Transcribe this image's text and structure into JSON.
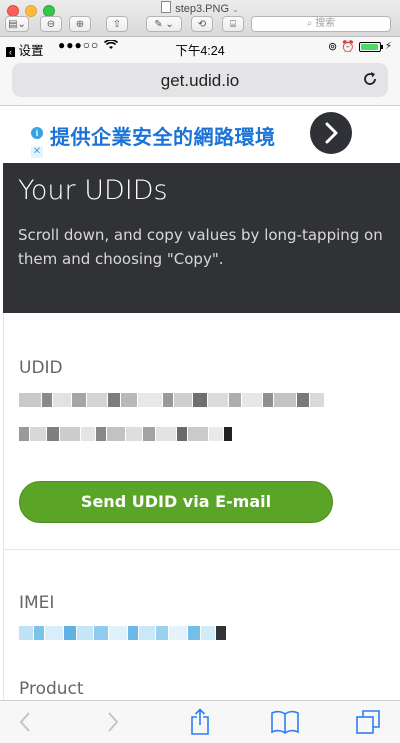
{
  "window": {
    "title": "step3.PNG",
    "search_placeholder": "搜索"
  },
  "status_bar": {
    "back_label": "设置",
    "carrier_dots": "●●●○○",
    "time": "下午4:24"
  },
  "address_bar": {
    "url": "get.udid.io"
  },
  "ad": {
    "text": "提供企業安全的網路環境",
    "info_glyph": "i",
    "close_glyph": "✕"
  },
  "hero": {
    "title": "Your UDIDs",
    "subtitle": "Scroll down, and copy values by long-tapping on them and choosing \"Copy\"."
  },
  "fields": {
    "udid_label": "UDID",
    "send_button": "Send UDID via E-mail",
    "imei_label": "IMEI",
    "product_label": "Product"
  },
  "colors": {
    "hero_bg": "#303236",
    "button_green": "#5aa528",
    "ad_blue": "#1a73d6",
    "link_blue": "#35a3e4"
  }
}
